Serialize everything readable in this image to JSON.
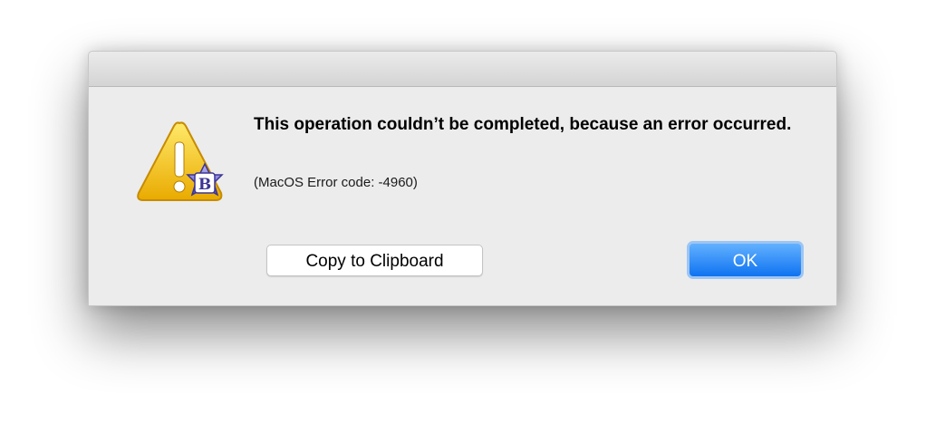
{
  "dialog": {
    "title": "This operation couldn’t be completed, because an error occurred.",
    "detail": "(MacOS Error code: -4960)",
    "buttons": {
      "copy_label": "Copy to Clipboard",
      "ok_label": "OK"
    },
    "icon": {
      "name": "warning-icon",
      "badge_name": "app-badge-icon",
      "badge_letter": "B"
    },
    "colors": {
      "warning_yellow": "#f4c614",
      "ok_blue": "#1a7ef5",
      "dialog_bg": "#ececec"
    }
  }
}
